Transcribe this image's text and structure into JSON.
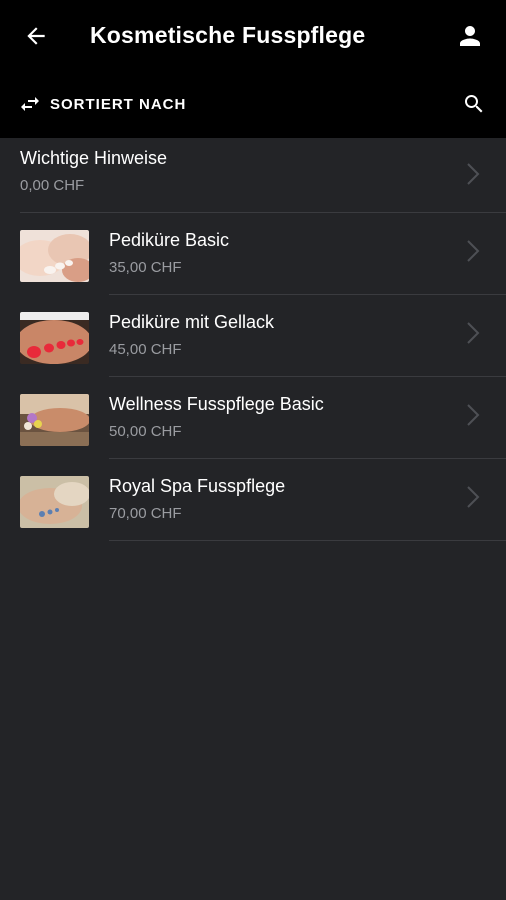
{
  "header": {
    "title": "Kosmetische Fusspflege",
    "back_icon": "arrow-left-icon",
    "profile_icon": "person-icon"
  },
  "toolbar": {
    "sort_label": "SORTIERT NACH",
    "sort_icon": "swap-arrows-icon",
    "search_icon": "search-icon"
  },
  "items": [
    {
      "name": "Wichtige Hinweise",
      "price": "0,00 CHF",
      "has_image": false
    },
    {
      "name": "Pediküre Basic",
      "price": "35,00 CHF",
      "has_image": true
    },
    {
      "name": "Pediküre mit Gellack",
      "price": "45,00 CHF",
      "has_image": true
    },
    {
      "name": "Wellness Fusspflege Basic",
      "price": "50,00 CHF",
      "has_image": true
    },
    {
      "name": "Royal Spa Fusspflege",
      "price": "70,00 CHF",
      "has_image": true
    }
  ],
  "colors": {
    "header_bg": "#000000",
    "page_bg": "#232427",
    "divider": "#3a3b3f",
    "price_text": "#9a9ca1"
  }
}
